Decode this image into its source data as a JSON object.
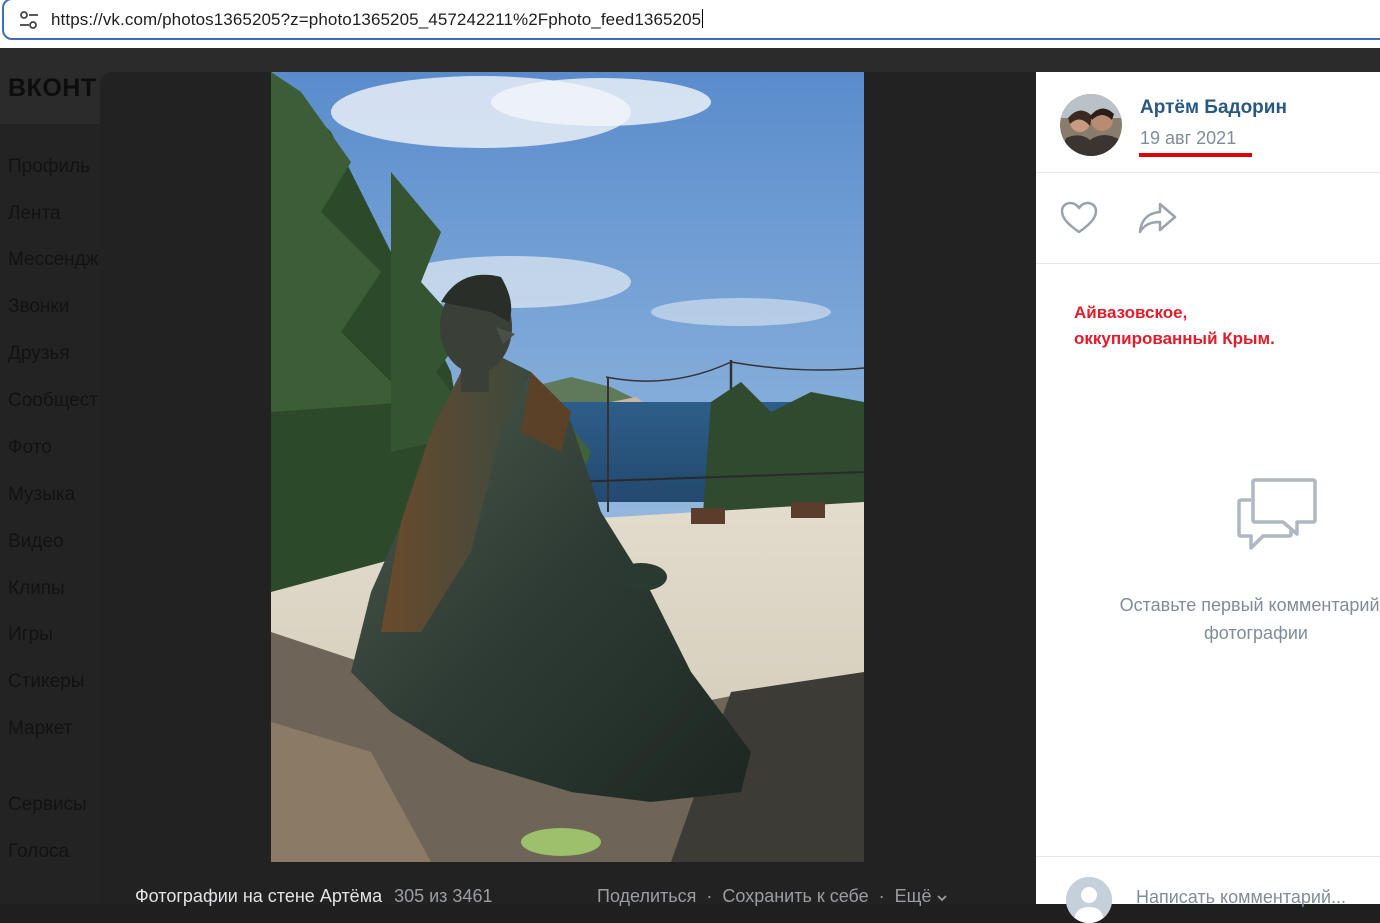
{
  "browser": {
    "url": "https://vk.com/photos1365205?z=photo1365205_457242211%2Fphoto_feed1365205"
  },
  "vk": {
    "logo": "ВКОНТ",
    "nav": [
      "Профиль",
      "Лента",
      "Мессендж",
      "Звонки",
      "Друзья",
      "Сообщест",
      "Фото",
      "Музыка",
      "Видео",
      "Клипы",
      "Игры",
      "Стикеры",
      "Маркет"
    ],
    "nav2": [
      "Сервисы",
      "Голоса"
    ]
  },
  "viewer": {
    "album_title": "Фотографии на стене Артёма",
    "counter": "305 из 3461",
    "share_label": "Поделиться",
    "save_label": "Сохранить к себе",
    "more_label": "Ещё"
  },
  "panel": {
    "author": "Артём Бадорин",
    "date": "19 авг 2021",
    "caption": "Айвазовское,\nоккупированный Крым.",
    "empty_comments": "Оставьте первый комментарий к\nфотографии",
    "comment_placeholder": "Написать комментарий..."
  },
  "colors": {
    "author_link": "#2a5885",
    "caption_red": "#e31b2a",
    "date_underline": "#e0000d",
    "muted": "#818c99"
  },
  "icons": [
    "tune-icon",
    "heart-icon",
    "share-arrow-icon",
    "comments-icon",
    "chevron-down-icon"
  ]
}
